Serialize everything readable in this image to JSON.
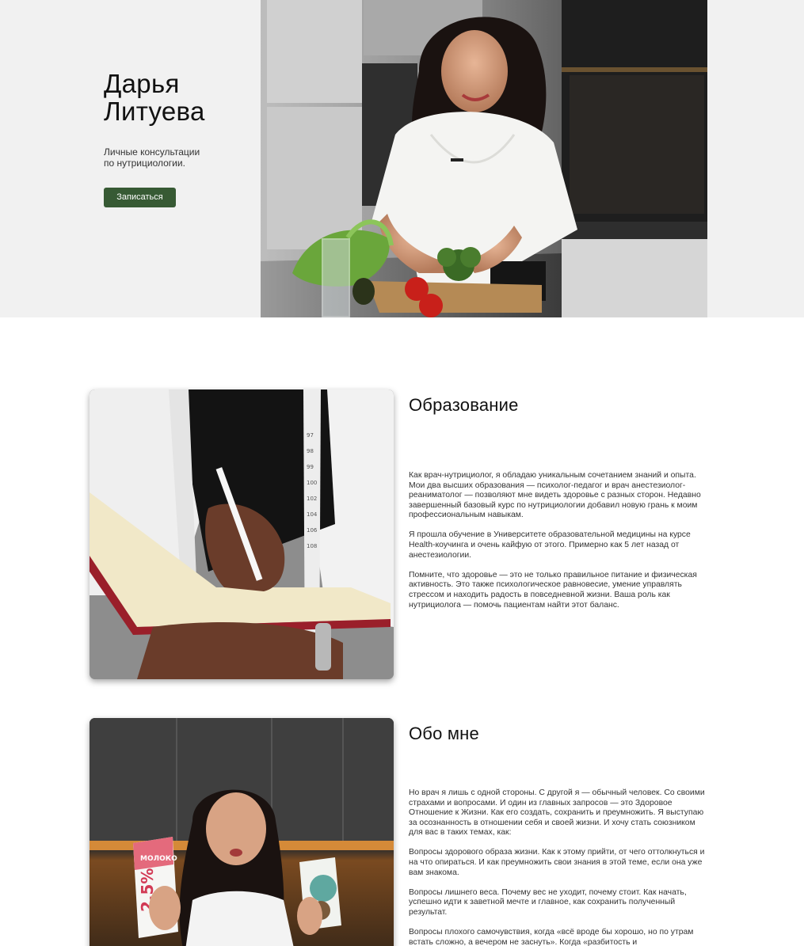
{
  "hero": {
    "title_line1": "Дарья",
    "title_line2": "Литуева",
    "subtitle_line1": "Личные консультации",
    "subtitle_line2": "по нутрициологии.",
    "cta_label": "Записаться"
  },
  "education": {
    "title": "Образование",
    "paragraphs": [
      "Как врач-нутрициолог, я обладаю уникальным сочетанием знаний и опыта. Мои два высших образования — психолог-педагог и врач анестезиолог-реаниматолог — позволяют мне видеть здоровье с разных сторон. Недавно завершенный базовый курс по нутрициологии добавил новую грань к моим профессиональным навыкам.",
      "Я прошла обучение в Университете образовательной медицины на курсе Health-коучинга и очень кайфую от этого. Примерно как 5 лет назад от анестезиологии.",
      "Помните, что здоровье — это не только правильное питание и физическая активность. Это также психологическое равновесие, умение управлять стрессом и находить радость в повседневной жизни. Ваша роль как нутрициолога — помочь пациентам найти этот баланс."
    ]
  },
  "about": {
    "title": "Обо мне",
    "paragraphs": [
      "Но врач я лишь с одной стороны. С другой я — обычный человек. Со своими страхами и вопросами. И один из главных запросов — это Здоровое Отношение к Жизни. Как его создать, сохранить и преумножить. Я выступаю за осознанность в отношении себя и своей жизни. И хочу стать союзником для вас в таких темах, как:",
      "Вопросы здорового образа жизни. Как к этому прийти, от чего оттолкнуться и на что опираться. И как преумножить свои знания в этой теме, если она уже вам знакома.",
      "Вопросы лишнего веса. Почему вес не уходит, почему стоит. Как начать, успешно идти к заветной мечте и главное, как сохранить полученный результат.",
      "Вопросы плохого самочувствия, когда «всё вроде бы хорошо, но по утрам встать сложно, а вечером не заснуть». Когда «разбитость и"
    ],
    "milk_pack_brand": "МОЛОКО",
    "milk_pack_fat": "2,5%"
  },
  "colors": {
    "hero_bg": "#f1f1f1",
    "accent_button": "#375a34",
    "text": "#333333"
  }
}
